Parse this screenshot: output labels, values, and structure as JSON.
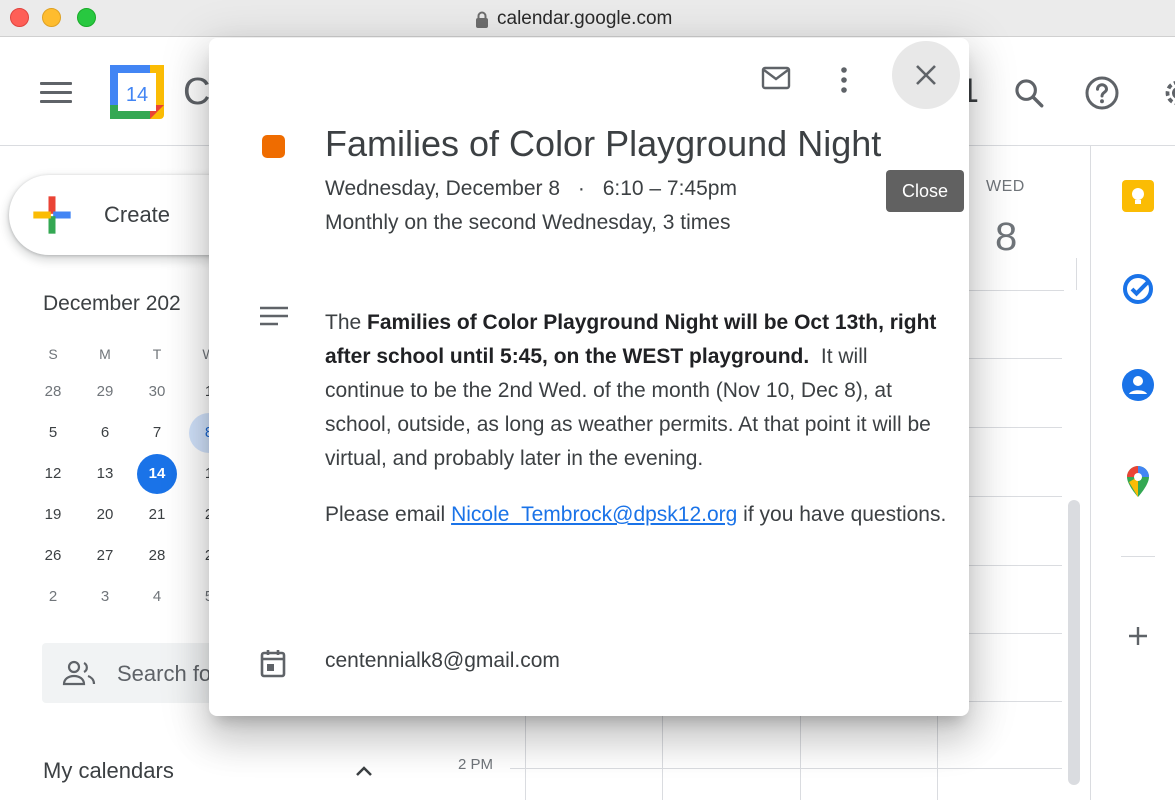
{
  "browser": {
    "url": "calendar.google.com"
  },
  "header": {
    "logo_day": "14",
    "brand_fragment": "C",
    "date_fragment": "1"
  },
  "left_panel": {
    "create_label": "Create",
    "mini_calendar": {
      "title": "December 202",
      "weekday_headers": [
        "S",
        "M",
        "T",
        "W"
      ],
      "rows": [
        [
          "28",
          "29",
          "30",
          "1"
        ],
        [
          "5",
          "6",
          "7",
          "8"
        ],
        [
          "12",
          "13",
          "14",
          "1"
        ],
        [
          "19",
          "20",
          "21",
          "2"
        ],
        [
          "26",
          "27",
          "28",
          "2"
        ],
        [
          "2",
          "3",
          "4",
          "5"
        ]
      ],
      "today": "14",
      "selected": "8"
    },
    "search_people_placeholder": "Search fo",
    "my_calendars_label": "My calendars"
  },
  "grid": {
    "day_name": "WED",
    "day_number": "8",
    "time_label": "2 PM"
  },
  "popup": {
    "event_color": "#ef6c00",
    "title": "Families of Color Playground Night",
    "date": "Wednesday, December 8",
    "separator": "·",
    "time": "6:10 – 7:45pm",
    "recurrence": "Monthly on the second Wednesday, 3 times",
    "description": {
      "p1_pre": "The ",
      "p1_bold": "Families of Color Playground Night will be Oct 13th, right after school until 5:45, on the WEST playground.",
      "p1_post": "  It will continue to be the 2nd Wed. of the month (Nov 10, Dec 8), at school, outside, as long as weather permits. At that point it will be virtual, and probably later in the evening.",
      "p2_pre": "Please email ",
      "p2_link": "Nicole_Tembrock@dpsk12.org",
      "p2_post": " if you have questions."
    },
    "calendar_owner": "centennialk8@gmail.com",
    "close_tooltip": "Close"
  },
  "colors": {
    "accent_blue": "#1a73e8",
    "event_orange": "#ef6c00",
    "keep_yellow": "#fbbc04",
    "tasks_blue": "#1a73e8",
    "contacts_blue": "#1a73e8"
  },
  "icons": {
    "popup_toolbar": [
      "mail-icon",
      "more-vert-icon",
      "close-icon"
    ],
    "header": [
      "hamburger-icon",
      "search-icon",
      "help-icon",
      "settings-icon"
    ],
    "side_panel": [
      "keep-icon",
      "tasks-icon",
      "contacts-icon",
      "maps-icon",
      "add-icon"
    ]
  }
}
